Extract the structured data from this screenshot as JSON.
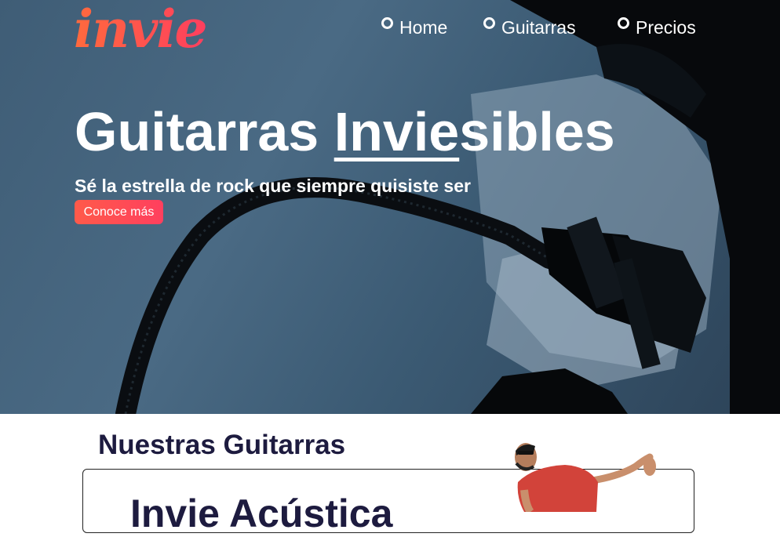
{
  "logo": {
    "text": "invie"
  },
  "nav": {
    "items": [
      "Home",
      "Guitarras",
      "Precios"
    ]
  },
  "hero": {
    "title_pre": "Guitarras ",
    "title_underlined": "Invie",
    "title_post": "sibles",
    "subtitle": "Sé la estrella de rock que siempre quisiste ser",
    "cta_label": "Conoce más"
  },
  "guitarras": {
    "title": "Nuestras Guitarras",
    "card_title": "Invie Acústica"
  },
  "colors": {
    "brand_gradient_start": "#ff6a3d",
    "brand_gradient_end": "#ff3f5e",
    "hero_overlay": "#3f5d76",
    "heading_dark": "#1d1b3f"
  }
}
